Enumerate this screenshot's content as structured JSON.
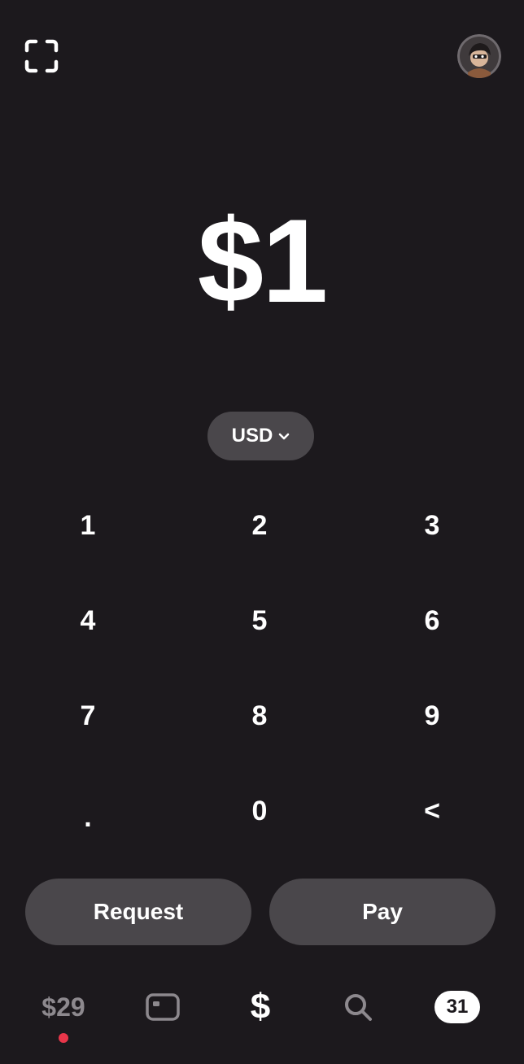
{
  "header": {
    "scan_icon": "qr-scan-icon",
    "avatar_icon": "profile-avatar"
  },
  "amount": {
    "value": "$1"
  },
  "currency": {
    "selected": "USD",
    "icon": "chevron-down-icon"
  },
  "keypad": {
    "keys": [
      "1",
      "2",
      "3",
      "4",
      "5",
      "6",
      "7",
      "8",
      "9",
      ".",
      "0",
      "<"
    ]
  },
  "actions": {
    "request_label": "Request",
    "pay_label": "Pay"
  },
  "tabbar": {
    "balance_label": "$29",
    "cash_label": "$",
    "activity_count": "31",
    "notification_color": "#e8364a"
  },
  "colors": {
    "background": "#1c191d",
    "pill": "#4a474b",
    "text": "#ffffff"
  }
}
